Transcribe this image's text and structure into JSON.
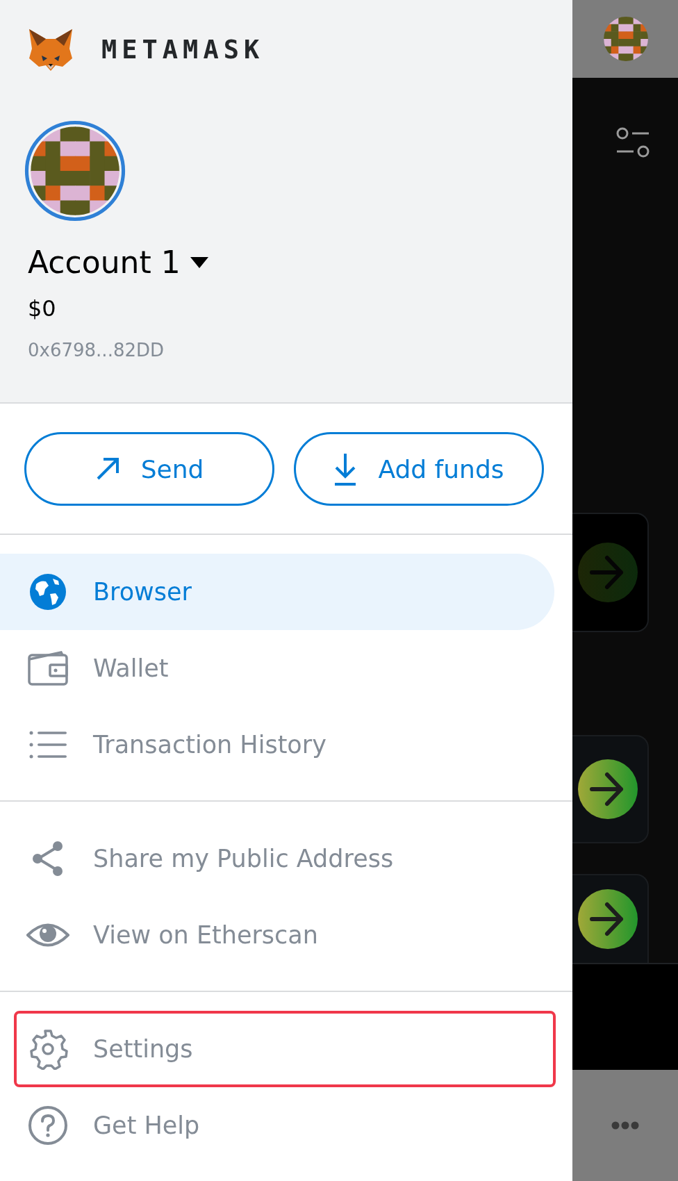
{
  "brand": "METAMASK",
  "account": {
    "name": "Account 1",
    "balance": "$0",
    "address": "0x6798...82DD"
  },
  "actions": [
    {
      "label": "Send"
    },
    {
      "label": "Add funds"
    }
  ],
  "menu_sections": [
    {
      "items": [
        {
          "label": "Browser",
          "selected": true,
          "outlined": false
        },
        {
          "label": "Wallet",
          "selected": false,
          "outlined": false
        },
        {
          "label": "Transaction History",
          "selected": false,
          "outlined": false
        }
      ]
    },
    {
      "items": [
        {
          "label": "Share my Public Address",
          "selected": false,
          "outlined": false
        },
        {
          "label": "View on Etherscan",
          "selected": false,
          "outlined": false
        }
      ]
    },
    {
      "items": [
        {
          "label": "Settings",
          "selected": false,
          "outlined": true
        },
        {
          "label": "Get Help",
          "selected": false,
          "outlined": false
        }
      ]
    }
  ]
}
